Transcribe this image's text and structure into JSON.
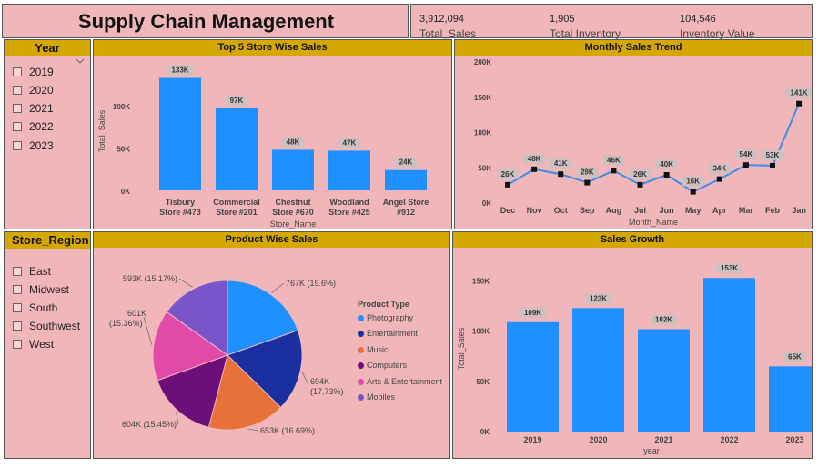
{
  "header": {
    "title": "Supply Chain Management"
  },
  "kpis": [
    {
      "value": "3,912,094",
      "label": "Total_Sales"
    },
    {
      "value": "1,905",
      "label": "Total Inventory"
    },
    {
      "value": "104,546",
      "label": "Inventory Value"
    }
  ],
  "year_slicer": {
    "title": "Year",
    "items": [
      "2019",
      "2020",
      "2021",
      "2022",
      "2023"
    ]
  },
  "region_slicer": {
    "title": "Store_Region",
    "items": [
      "East",
      "Midwest",
      "South",
      "Southwest",
      "West"
    ]
  },
  "colors": {
    "panel": "#f1b6ba",
    "header": "#d4a800",
    "bar": "#1f90ff",
    "line": "#3a8ee8",
    "marker": "#111111"
  },
  "charts": {
    "store_sales": {
      "title": "Top 5 Store Wise Sales",
      "type": "bar",
      "categories": [
        "Tisbury Store #473",
        "Commercial Store #201",
        "Chestnut Store #670",
        "Woodland Store #425",
        "Angel Store #912"
      ],
      "category_lines": [
        [
          "Tisbury",
          "Store #473"
        ],
        [
          "Commercial",
          "Store #201"
        ],
        [
          "Chestnut",
          "Store #670"
        ],
        [
          "Woodland",
          "Store #425"
        ],
        [
          "Angel Store",
          "#912"
        ]
      ],
      "values": [
        133,
        97,
        48,
        47,
        24
      ],
      "data_labels": [
        "133K",
        "97K",
        "48K",
        "47K",
        "24K"
      ],
      "ylim": [
        0,
        140
      ],
      "yticks": [
        0,
        50,
        100
      ],
      "ytick_labels": [
        "0K",
        "50K",
        "100K"
      ],
      "xlabel": "Store_Name",
      "ylabel": "Total_Sales"
    },
    "monthly_trend": {
      "title": "Monthly Sales Trend",
      "type": "line",
      "categories": [
        "Dec",
        "Nov",
        "Oct",
        "Sep",
        "Aug",
        "Jul",
        "Jun",
        "May",
        "Apr",
        "Mar",
        "Feb",
        "Jan"
      ],
      "values": [
        26,
        48,
        41,
        29,
        46,
        26,
        40,
        16,
        34,
        54,
        53,
        141
      ],
      "data_labels": [
        "26K",
        "48K",
        "41K",
        "29K",
        "46K",
        "26K",
        "40K",
        "16K",
        "34K",
        "54K",
        "53K",
        "141K"
      ],
      "ylim": [
        0,
        200
      ],
      "yticks": [
        0,
        50,
        100,
        150,
        200
      ],
      "ytick_labels": [
        "0K",
        "50K",
        "100K",
        "150K",
        "200K"
      ],
      "xlabel": "Month_Name"
    },
    "product_sales": {
      "title": "Product Wise Sales",
      "type": "pie",
      "legend_title": "Product Type",
      "slices": [
        {
          "name": "Photography",
          "value": 767,
          "label": "767K (19.6%)",
          "color": "#1f90ff"
        },
        {
          "name": "Entertainment",
          "value": 694,
          "label": "694K (17.73%)",
          "color": "#1a2fa0"
        },
        {
          "name": "Music",
          "value": 653,
          "label": "653K (16.69%)",
          "color": "#e8713a"
        },
        {
          "name": "Computers",
          "value": 604,
          "label": "604K (15.45%)",
          "color": "#6c0f7a"
        },
        {
          "name": "Arts & Entertainment",
          "value": 601,
          "label": "601K (15.36%)",
          "color": "#e14aa8"
        },
        {
          "name": "Mobiles",
          "value": 593,
          "label": "593K (15.17%)",
          "color": "#7a55c9"
        }
      ]
    },
    "sales_growth": {
      "title": "Sales Growth",
      "type": "bar",
      "categories": [
        "2019",
        "2020",
        "2021",
        "2022",
        "2023"
      ],
      "values": [
        109,
        123,
        102,
        153,
        65
      ],
      "data_labels": [
        "109K",
        "123K",
        "102K",
        "153K",
        "65K"
      ],
      "ylim": [
        0,
        165
      ],
      "yticks": [
        0,
        50,
        100,
        150
      ],
      "ytick_labels": [
        "0K",
        "50K",
        "100K",
        "150K"
      ],
      "xlabel": "year",
      "ylabel": "Total_Sales"
    }
  }
}
